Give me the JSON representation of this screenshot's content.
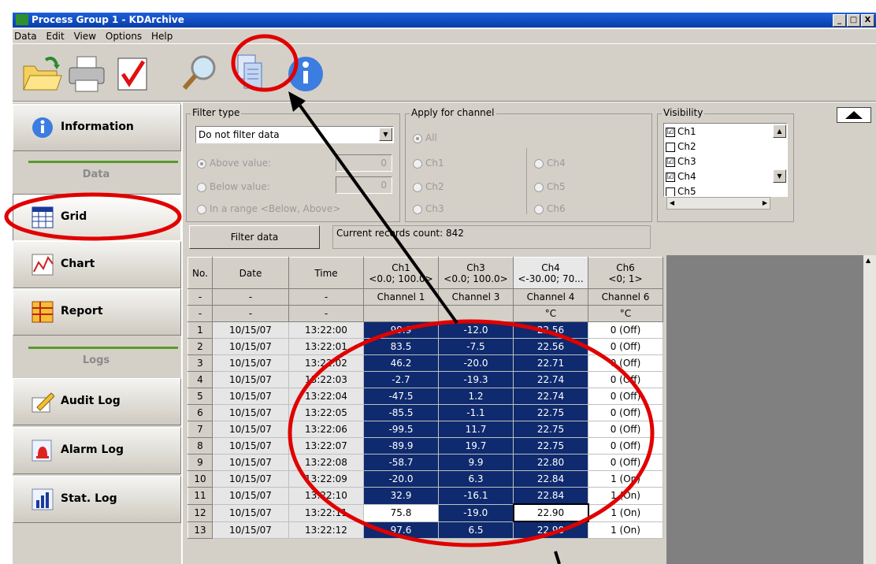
{
  "window": {
    "title": "Process Group 1 - KDArchive",
    "buttons": [
      "_",
      "□",
      "X"
    ]
  },
  "menu": [
    "Data",
    "Edit",
    "View",
    "Options",
    "Help"
  ],
  "toolbar": {
    "icons": [
      "open-folder-icon",
      "print-icon",
      "check-icon",
      "search-icon",
      "copy-icon",
      "info-icon"
    ]
  },
  "sidebar": {
    "data_group": "Data",
    "logs_group": "Logs",
    "items": [
      {
        "label": "Information",
        "icon": "info-icon"
      },
      {
        "label": "Grid",
        "icon": "grid-icon"
      },
      {
        "label": "Chart",
        "icon": "chart-icon"
      },
      {
        "label": "Report",
        "icon": "report-icon"
      },
      {
        "label": "Audit Log",
        "icon": "pencil-icon"
      },
      {
        "label": "Alarm Log",
        "icon": "bell-icon"
      },
      {
        "label": "Stat. Log",
        "icon": "bar-icon"
      }
    ]
  },
  "filter": {
    "legend": "Filter type",
    "selected": "Do not filter data",
    "above_label": "Above value:",
    "above_value": "0",
    "below_label": "Below value:",
    "below_value": "0",
    "range_label": "In a range <Below, Above>",
    "button": "Filter data",
    "records": "Current records count: 842"
  },
  "apply": {
    "legend": "Apply for channel",
    "all": "All",
    "ch1": "Ch1",
    "ch2": "Ch2",
    "ch3": "Ch3",
    "ch4": "Ch4",
    "ch5": "Ch5",
    "ch6": "Ch6"
  },
  "visibility": {
    "legend": "Visibility",
    "items": [
      {
        "label": "Ch1",
        "checked": "☑"
      },
      {
        "label": "Ch2",
        "checked": ""
      },
      {
        "label": "Ch3",
        "checked": "☑"
      },
      {
        "label": "Ch4",
        "checked": "☑"
      },
      {
        "label": "Ch5",
        "checked": ""
      }
    ]
  },
  "grid": {
    "headers": [
      {
        "l1": "No.",
        "l2": ""
      },
      {
        "l1": "Date",
        "l2": ""
      },
      {
        "l1": "Time",
        "l2": ""
      },
      {
        "l1": "Ch1",
        "l2": "<0.0; 100.0>"
      },
      {
        "l1": "Ch3",
        "l2": "<0.0; 100.0>"
      },
      {
        "l1": "Ch4",
        "l2": "<-30.00; 70..."
      },
      {
        "l1": "Ch6",
        "l2": "<0; 1>"
      }
    ],
    "names": [
      "-",
      "-",
      "-",
      "Channel 1",
      "Channel 3",
      "Channel 4",
      "Channel 6"
    ],
    "units": [
      "-",
      "-",
      "-",
      "",
      "",
      "°C",
      "°C"
    ],
    "rows": [
      [
        "1",
        "10/15/07",
        "13:22:00",
        "99.9",
        "-12.0",
        "22.56",
        "0 (Off)"
      ],
      [
        "2",
        "10/15/07",
        "13:22:01",
        "83.5",
        "-7.5",
        "22.56",
        "0 (Off)"
      ],
      [
        "3",
        "10/15/07",
        "13:22:02",
        "46.2",
        "-20.0",
        "22.71",
        "0 (Off)"
      ],
      [
        "4",
        "10/15/07",
        "13:22:03",
        "-2.7",
        "-19.3",
        "22.74",
        "0 (Off)"
      ],
      [
        "5",
        "10/15/07",
        "13:22:04",
        "-47.5",
        "1.2",
        "22.74",
        "0 (Off)"
      ],
      [
        "6",
        "10/15/07",
        "13:22:05",
        "-85.5",
        "-1.1",
        "22.75",
        "0 (Off)"
      ],
      [
        "7",
        "10/15/07",
        "13:22:06",
        "-99.5",
        "11.7",
        "22.75",
        "0 (Off)"
      ],
      [
        "8",
        "10/15/07",
        "13:22:07",
        "-89.9",
        "19.7",
        "22.75",
        "0 (Off)"
      ],
      [
        "9",
        "10/15/07",
        "13:22:08",
        "-58.7",
        "9.9",
        "22.80",
        "0 (Off)"
      ],
      [
        "10",
        "10/15/07",
        "13:22:09",
        "-20.0",
        "6.3",
        "22.84",
        "1 (On)"
      ],
      [
        "11",
        "10/15/07",
        "13:22:10",
        "32.9",
        "-16.1",
        "22.84",
        "1 (On)"
      ],
      [
        "12",
        "10/15/07",
        "13:22:11",
        "75.8",
        "-19.0",
        "22.90",
        "1 (On)"
      ],
      [
        "13",
        "10/15/07",
        "13:22:12",
        "97.6",
        "6.5",
        "22.90",
        "1 (On)"
      ]
    ]
  },
  "colors": {
    "selection": "#0f2a6e",
    "annotation": "#e00000"
  }
}
